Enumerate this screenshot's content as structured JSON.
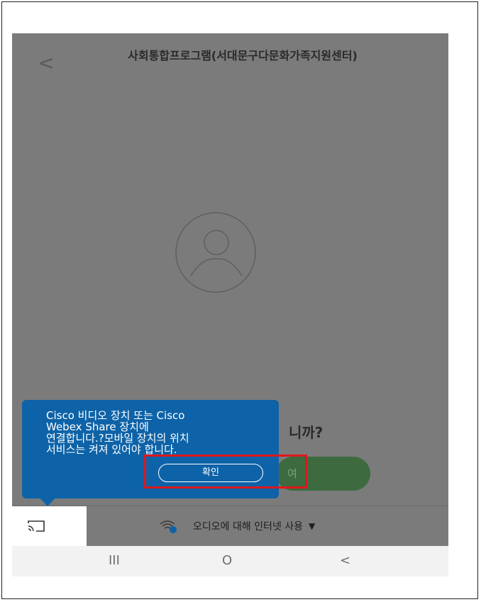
{
  "header": {
    "back_glyph": "<",
    "title": "사회통합프로그램(서대문구다문화가족지원센터)"
  },
  "main": {
    "question_fragment": "니까?",
    "join_button_label": "여"
  },
  "tooltip": {
    "message": "Cisco 비디오 장치 또는 Cisco\nWebex Share 장치에\n연결합니다.?모바일 장치의 위치\n서비스는 켜져 있어야 합니다.",
    "confirm_label": "확인"
  },
  "bottom_bar": {
    "audio_label": "오디오에 대해 인터넷 사용",
    "dropdown_glyph": "▼"
  },
  "nav": {
    "recents_glyph": "III",
    "home_glyph": "O",
    "back_glyph": "<"
  },
  "colors": {
    "overlay": "#7b7b7b",
    "tooltip": "#0e63a8",
    "highlight": "#e0161b",
    "join_button": "#3d6b3f"
  },
  "icons": [
    "back-arrow-icon",
    "avatar-icon",
    "cast-icon",
    "wifi-audio-icon",
    "dropdown-caret-icon"
  ]
}
